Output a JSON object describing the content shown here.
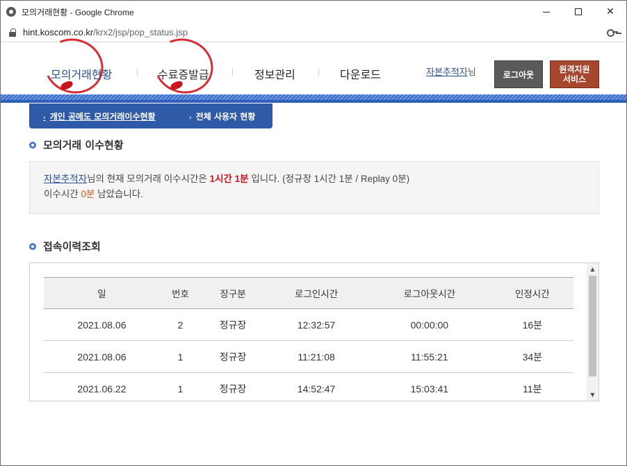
{
  "window": {
    "title": "모의거래현황 - Google Chrome"
  },
  "address": {
    "host": "hint.koscom.co.kr",
    "path": "/krx2/jsp/pop_status.jsp"
  },
  "gnb": {
    "items": [
      "모의거래현황",
      "수료증발급",
      "정보관리",
      "다운로드"
    ],
    "user_name": "자본추적자",
    "user_suffix": "님",
    "logout_label": "로그아웃",
    "remote_label_1": "원격지원",
    "remote_label_2": "서비스"
  },
  "subnav": {
    "items": [
      "개인 공메도 모의거래이수현황",
      "전체 사용자 현황"
    ]
  },
  "status": {
    "section_title": "모의거래 이수현황",
    "user_name": "자본추적자",
    "line1_mid": "님의 현재 모의거래 이수시간은 ",
    "time": "1시간 1분",
    "line1_end": " 입니다. (정규장 1시간 1분 / Replay 0분)",
    "line2_start": "이수시간 ",
    "remaining": "0분",
    "line2_end": " 남았습니다."
  },
  "history": {
    "section_title": "접속이력조회",
    "columns": [
      "일",
      "번호",
      "장구분",
      "로그인시간",
      "로그아웃시간",
      "인정시간"
    ],
    "rows": [
      [
        "2021.08.06",
        "2",
        "정규장",
        "12:32:57",
        "00:00:00",
        "16분"
      ],
      [
        "2021.08.06",
        "1",
        "정규장",
        "11:21:08",
        "11:55:21",
        "34분"
      ],
      [
        "2021.06.22",
        "1",
        "정규장",
        "14:52:47",
        "15:03:41",
        "11분"
      ]
    ]
  },
  "colors": {
    "brand_blue": "#2f5aa8",
    "accent_red": "#c8141c",
    "remote_btn": "#a7462f",
    "logout_btn": "#5a5a5a"
  }
}
